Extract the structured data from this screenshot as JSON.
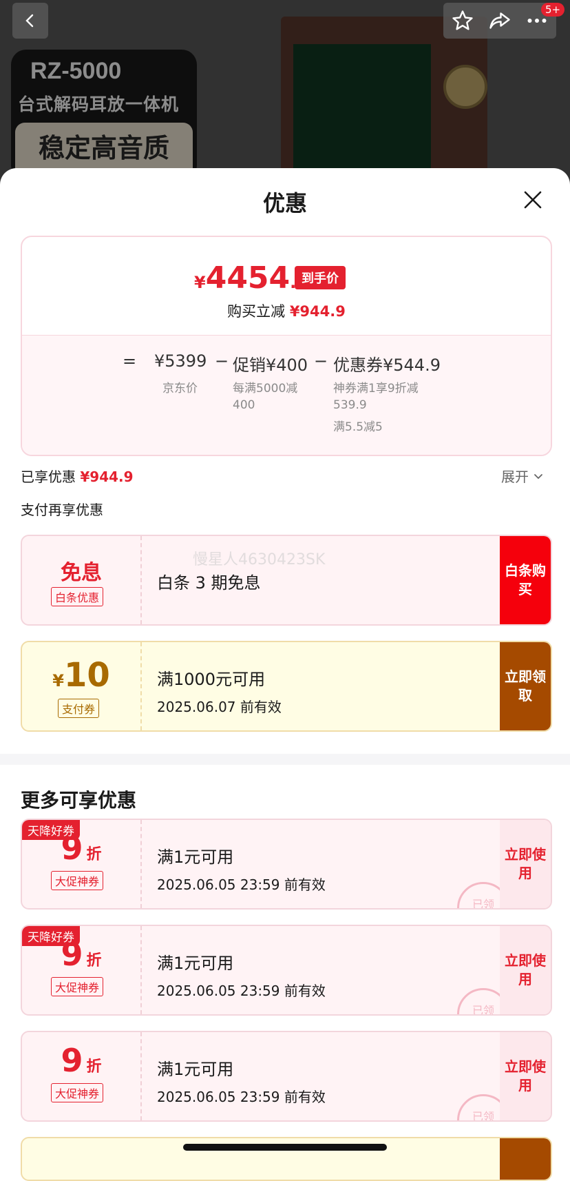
{
  "product_image": {
    "model": "RZ-5000",
    "subtitle": "台式解码耳放一体机",
    "badge": "稳定高音质"
  },
  "top_nav": {
    "back_icon": "chevron-left-icon",
    "star_icon": "star-icon",
    "share_icon": "share-icon",
    "more_icon": "more-icon",
    "message_badge": "5+"
  },
  "sheet": {
    "title": "优惠",
    "close_icon": "close-icon"
  },
  "price_summary": {
    "currency": "¥",
    "price_int": "4454",
    "price_dec": ".1",
    "price_tag": "到手价",
    "instant_label": "购买立减",
    "instant_value": "¥944.9",
    "eq": "=",
    "jd_price": "¥5399",
    "jd_label": "京东价",
    "minus1": "−",
    "promo": "促销¥400",
    "promo_desc_1": "每满5000减",
    "promo_desc_2": "400",
    "minus2": "−",
    "coupon": "优惠券¥544.9",
    "coupon_desc_1": "神券满1享9折减",
    "coupon_desc_2": "539.9",
    "coupon_desc_3": "满5.5减5"
  },
  "enjoyed": {
    "label": "已享优惠",
    "value": "¥944.9",
    "expand": "展开"
  },
  "pay_section_title": "支付再享优惠",
  "pay_coupons": [
    {
      "big": "免息",
      "tag": "白条优惠",
      "title": "白条 3 期免息",
      "action": "白条购买"
    },
    {
      "currency": "¥",
      "big": "10",
      "tag": "支付券",
      "title": "满1000元可用",
      "sub": "2025.06.07 前有效",
      "action": "立即领取"
    }
  ],
  "more_title": "更多可享优惠",
  "more_coupons": [
    {
      "sky_tag": "天降好券",
      "nine": "9",
      "zhe": "折",
      "tag": "大促神券",
      "title": "满1元可用",
      "sub": "2025.06.05 23:59 前有效",
      "action": "立即使用",
      "stamp": "已领"
    },
    {
      "sky_tag": "天降好券",
      "nine": "9",
      "zhe": "折",
      "tag": "大促神券",
      "title": "满1元可用",
      "sub": "2025.06.05 23:59 前有效",
      "action": "立即使用",
      "stamp": "已领"
    },
    {
      "nine": "9",
      "zhe": "折",
      "tag": "大促神券",
      "title": "满1元可用",
      "sub": "2025.06.05 23:59 前有效",
      "action": "立即使用",
      "stamp": "已领"
    }
  ],
  "watermark": "慢星人4630423SK",
  "colors": {
    "brand_red": "#e4212f",
    "brown_action": "#a54a00",
    "gold": "#a86a00",
    "pink_bg": "#fff3f5",
    "yellow_bg": "#fffde4"
  }
}
